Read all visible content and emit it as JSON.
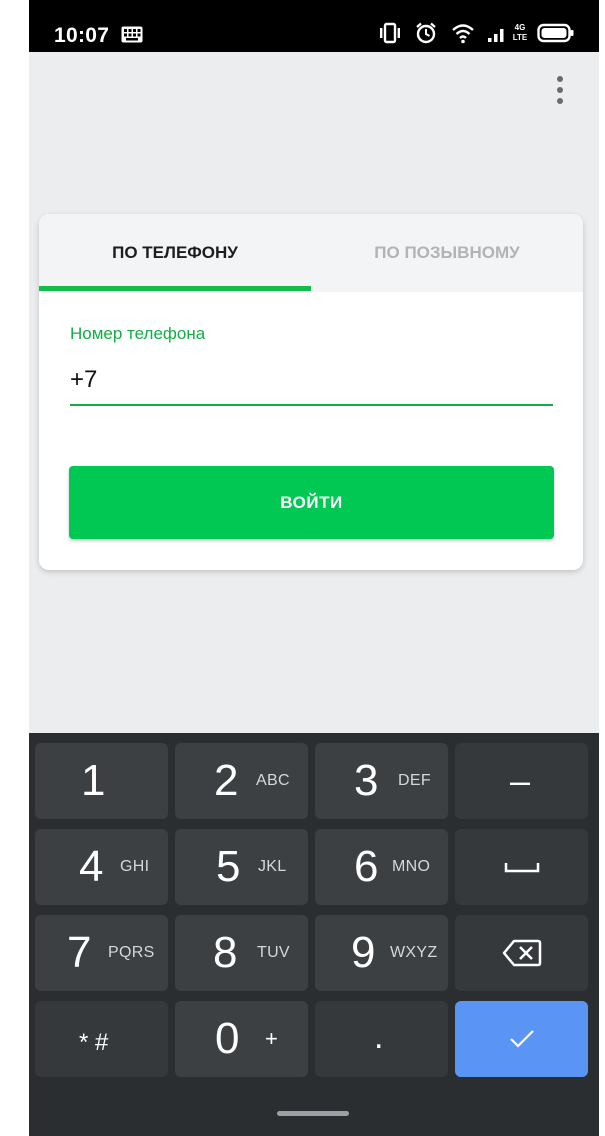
{
  "status_bar": {
    "time": "10:07",
    "network_badge_top": "4G",
    "network_badge_bottom": "LTE"
  },
  "tabs": [
    {
      "label": "ПО ТЕЛЕФОНУ",
      "active": true
    },
    {
      "label": "ПО ПОЗЫВНОМУ",
      "active": false
    }
  ],
  "form": {
    "phone_label": "Номер телефона",
    "phone_value": "+7",
    "submit_label": "ВОЙТИ"
  },
  "keyboard": {
    "rows": [
      [
        {
          "main": "1",
          "sub": ""
        },
        {
          "main": "2",
          "sub": "ABC"
        },
        {
          "main": "3",
          "sub": "DEF"
        },
        {
          "main": "–",
          "sub": ""
        }
      ],
      [
        {
          "main": "4",
          "sub": "GHI"
        },
        {
          "main": "5",
          "sub": "JKL"
        },
        {
          "main": "6",
          "sub": "MNO"
        },
        {
          "main": "",
          "sub": ""
        }
      ],
      [
        {
          "main": "7",
          "sub": "PQRS"
        },
        {
          "main": "8",
          "sub": "TUV"
        },
        {
          "main": "9",
          "sub": "WXYZ"
        },
        {
          "main": "",
          "sub": ""
        }
      ],
      [
        {
          "main": "* #",
          "sub": ""
        },
        {
          "main": "0",
          "sub": "+"
        },
        {
          "main": ".",
          "sub": ""
        },
        {
          "main": "",
          "sub": ""
        }
      ]
    ]
  },
  "colors": {
    "accent_green": "#12bd4c",
    "button_green": "#00c853",
    "keyboard_enter_blue": "#5a95f5"
  },
  "icons": {
    "status_left": "keyboard-icon",
    "status_right": [
      "vibrate-icon",
      "alarm-icon",
      "wifi-icon",
      "signal-icon",
      "battery-icon"
    ],
    "menu": "overflow-menu-icon",
    "keys": [
      "space-icon",
      "backspace-icon",
      "check-icon"
    ]
  }
}
